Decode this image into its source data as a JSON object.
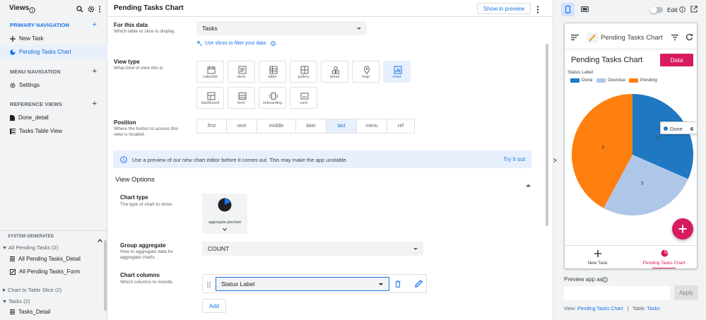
{
  "sidebar": {
    "title": "Views",
    "primary_nav_label": "PRIMARY NAVIGATION",
    "primary_items": [
      {
        "label": "New Task",
        "icon": "plus-icon"
      },
      {
        "label": "Pending Tasks Chart",
        "icon": "pie-chart-icon"
      }
    ],
    "menu_nav_label": "MENU NAVIGATION",
    "menu_items": [
      {
        "label": "Settings",
        "icon": "gear-icon"
      }
    ],
    "reference_views_label": "REFERENCE VIEWS",
    "reference_items": [
      {
        "label": "Done_detail",
        "icon": "document-icon"
      },
      {
        "label": "Tasks Table View",
        "icon": "table-icon"
      }
    ],
    "system_generated_label": "SYSTEM GENERATED",
    "system_groups": [
      {
        "label": "All Pending Tasks (2)",
        "items": [
          "All Pending Tasks_Detail",
          "All Pending Tasks_Form"
        ]
      },
      {
        "label": "Chart to Table Slice (2)",
        "items": []
      },
      {
        "label": "Tasks (2)",
        "items": [
          "Tasks_Detail"
        ]
      }
    ]
  },
  "editor": {
    "title": "Pending Tasks Chart",
    "show_in_preview": "Show in preview",
    "for_this_data": {
      "label": "For this data",
      "desc": "Which table or slice to display.",
      "value": "Tasks",
      "slice_link": "Use slices to filter your data"
    },
    "view_type": {
      "label": "View type",
      "desc": "What kind of view this is.",
      "options": [
        "calendar",
        "deck",
        "table",
        "gallery",
        "detail",
        "map",
        "chart",
        "dashboard",
        "form",
        "onboarding",
        "card"
      ],
      "selected": "chart"
    },
    "position": {
      "label": "Position",
      "desc": "Where the button to access this view is located.",
      "options": [
        "first",
        "next",
        "middle",
        "later",
        "last",
        "menu",
        "ref"
      ],
      "selected": "last"
    },
    "banner": {
      "text": "Use a preview of our new chart editor before it comes out. This may make the app unstable.",
      "action": "Try it out"
    },
    "view_options_label": "View Options",
    "chart_type": {
      "label": "Chart type",
      "desc": "The type of chart to show.",
      "value": "aggregate piechart"
    },
    "group_aggregate": {
      "label": "Group aggregate",
      "desc": "How to aggregate data for aggregate charts.",
      "value": "COUNT"
    },
    "chart_columns": {
      "label": "Chart columns",
      "desc": "Which columns to include.",
      "value": "Status Label",
      "add_label": "Add"
    }
  },
  "preview": {
    "edit_label": "Edit",
    "app_title": "Pending Tasks Chart",
    "chart_title": "Pending Tasks Chart",
    "data_button": "Data",
    "legend_title": "Status Label",
    "tooltip": {
      "label": "Done",
      "value": "6"
    },
    "nav": [
      {
        "label": "New Task",
        "icon": "plus-icon"
      },
      {
        "label": "Pending Tasks Chart",
        "icon": "pie-chart-icon"
      }
    ],
    "preview_as_label": "Preview app as",
    "apply_label": "Apply",
    "view_label": "View:",
    "view_value": "Pending Tasks Chart",
    "table_label": "Table:",
    "table_value": "Tasks",
    "separator": "|"
  },
  "colors": {
    "accent": "#1a73e8",
    "pink": "#d81b60",
    "done": "#1f78c1",
    "overdue": "#aec7e8",
    "pending": "#ff7f0e"
  },
  "chart_data": {
    "type": "pie",
    "title": "Pending Tasks Chart",
    "legend_title": "Status Label",
    "categories": [
      "Done",
      "Overdue",
      "Pending"
    ],
    "values": [
      6,
      5,
      8
    ],
    "colors": [
      "#1f78c1",
      "#aec7e8",
      "#ff7f0e"
    ]
  }
}
